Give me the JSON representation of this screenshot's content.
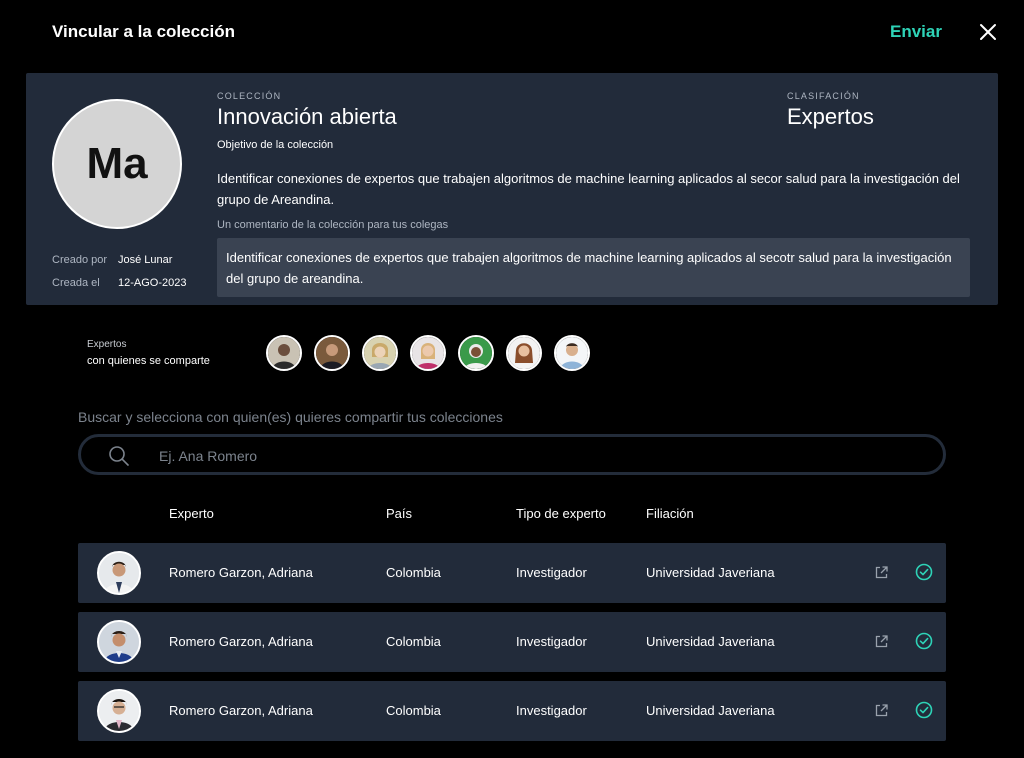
{
  "header": {
    "title": "Vincular a la colección",
    "send_label": "Enviar"
  },
  "collection": {
    "initials": "Ma",
    "created_by_label": "Creado por",
    "created_by": "José Lunar",
    "created_on_label": "Creada el",
    "created_on": "12-AGO-2023",
    "collection_label": "COLECCIÓN",
    "name": "Innovación abierta",
    "classification_label": "CLASIFACIÓN",
    "classification": "Expertos",
    "objective_label": "Objetivo de la colección",
    "objective": "Identificar conexiones de expertos que trabajen algoritmos de machine learning aplicados al secor salud para la investigación del grupo de Areandina.",
    "comment_label": "Un comentario de la colección para tus colegas",
    "comment": "Identificar conexiones de expertos que trabajen algoritmos de machine learning aplicados al secotr salud para la investigación del grupo de areandina."
  },
  "shared": {
    "label_line1": "Expertos",
    "label_line2": "con quienes se comparte"
  },
  "search": {
    "label": "Buscar y selecciona con quien(es) quieres compartir tus colecciones",
    "placeholder": "Ej. Ana Romero",
    "value": ""
  },
  "table": {
    "headers": {
      "expert": "Experto",
      "country": "País",
      "type": "Tipo de experto",
      "affiliation": "Filiación"
    },
    "rows": [
      {
        "name": "Romero Garzon, Adriana",
        "country": "Colombia",
        "type": "Investigador",
        "affiliation": "Universidad Javeriana"
      },
      {
        "name": "Romero Garzon, Adriana",
        "country": "Colombia",
        "type": "Investigador",
        "affiliation": "Universidad Javeriana"
      },
      {
        "name": "Romero Garzon, Adriana",
        "country": "Colombia",
        "type": "Investigador",
        "affiliation": "Universidad Javeriana"
      }
    ]
  },
  "colors": {
    "accent": "#2ed3b7",
    "card_bg": "#222b3a",
    "comment_bg": "#3a4352",
    "muted_text": "#7c838d"
  },
  "icons": {
    "close": "close-icon",
    "search": "search-icon",
    "external_link": "external-link-icon",
    "selected": "check-circle-icon"
  }
}
